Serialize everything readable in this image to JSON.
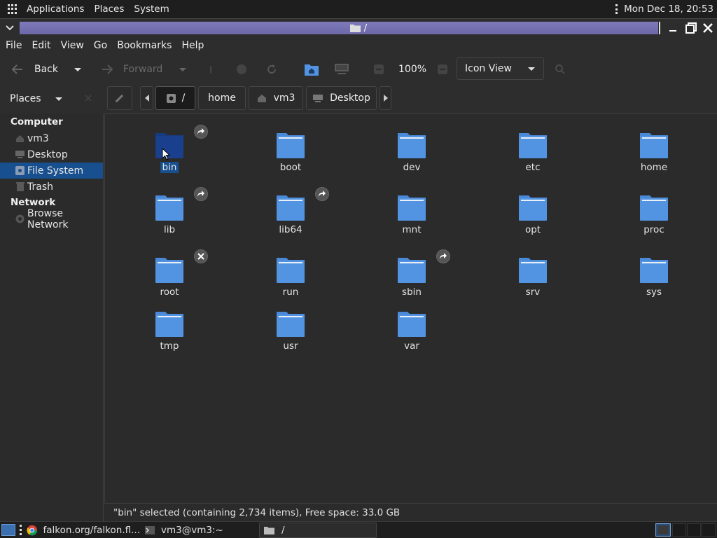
{
  "top_panel": {
    "applications": "Applications",
    "places": "Places",
    "system": "System",
    "clock": "Mon Dec 18, 20:53"
  },
  "window": {
    "title": "/"
  },
  "menu": {
    "file": "File",
    "edit": "Edit",
    "view": "View",
    "go": "Go",
    "bookmarks": "Bookmarks",
    "help": "Help"
  },
  "toolbar": {
    "back": "Back",
    "forward": "Forward",
    "zoom": "100%",
    "view_mode": "Icon View"
  },
  "location": {
    "places_label": "Places",
    "path": [
      "/",
      "home",
      "vm3",
      "Desktop"
    ]
  },
  "sidebar": {
    "computer_header": "Computer",
    "network_header": "Network",
    "items": [
      {
        "label": "vm3",
        "icon": "home-icon"
      },
      {
        "label": "Desktop",
        "icon": "desktop-icon"
      },
      {
        "label": "File System",
        "icon": "drive-icon",
        "selected": true
      },
      {
        "label": "Trash",
        "icon": "trash-icon"
      }
    ],
    "network_items": [
      {
        "label": "Browse Network",
        "icon": "network-icon"
      }
    ]
  },
  "files": [
    {
      "name": "bin",
      "emblem": "symlink",
      "selected": true
    },
    {
      "name": "boot"
    },
    {
      "name": "dev"
    },
    {
      "name": "etc"
    },
    {
      "name": "home"
    },
    {
      "name": "lib",
      "emblem": "symlink"
    },
    {
      "name": "lib64",
      "emblem": "symlink"
    },
    {
      "name": "mnt"
    },
    {
      "name": "opt"
    },
    {
      "name": "proc"
    },
    {
      "name": "root",
      "emblem": "locked"
    },
    {
      "name": "run"
    },
    {
      "name": "sbin",
      "emblem": "symlink"
    },
    {
      "name": "srv"
    },
    {
      "name": "sys"
    },
    {
      "name": "tmp"
    },
    {
      "name": "usr"
    },
    {
      "name": "var"
    }
  ],
  "status": "\"bin\" selected (containing 2,734 items), Free space: 33.0 GB",
  "taskbar": {
    "tasks": [
      "falkon.org/falkon.fl...",
      "vm3@vm3:~",
      "/"
    ]
  },
  "colors": {
    "folder": "#5294e2",
    "folder_selected": "#1a3f8c",
    "selection": "#184f8f",
    "title_strip": "#7470b0"
  }
}
